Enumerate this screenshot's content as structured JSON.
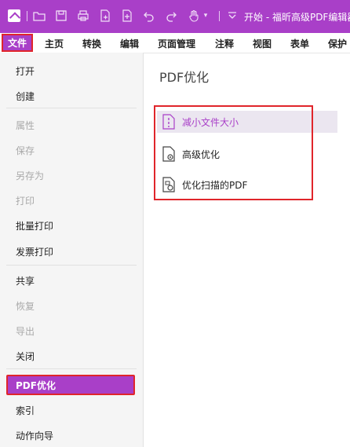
{
  "window": {
    "title": "开始 - 福昕高级PDF编辑器",
    "accent_color": "#a93fc8",
    "highlight_color": "#e0252b"
  },
  "quick_access": [
    "open-folder-icon",
    "save-icon",
    "print-icon",
    "new-doc-icon",
    "add-page-icon",
    "undo-icon",
    "redo-icon",
    "hand-tool-icon",
    "dropdown-icon"
  ],
  "menu": {
    "items": [
      "文件",
      "主页",
      "转换",
      "编辑",
      "页面管理",
      "注释",
      "视图",
      "表单",
      "保护"
    ],
    "active": "文件"
  },
  "sidebar": {
    "items": [
      {
        "label": "打开",
        "disabled": false
      },
      {
        "label": "创建",
        "disabled": false
      },
      {
        "label": "属性",
        "disabled": true
      },
      {
        "label": "保存",
        "disabled": true
      },
      {
        "label": "另存为",
        "disabled": true
      },
      {
        "label": "打印",
        "disabled": true
      },
      {
        "label": "批量打印",
        "disabled": false
      },
      {
        "label": "发票打印",
        "disabled": false
      },
      {
        "label": "共享",
        "disabled": false
      },
      {
        "label": "恢复",
        "disabled": true
      },
      {
        "label": "导出",
        "disabled": true
      },
      {
        "label": "关闭",
        "disabled": false
      },
      {
        "label": "PDF优化",
        "disabled": false
      },
      {
        "label": "索引",
        "disabled": false
      },
      {
        "label": "动作向导",
        "disabled": false
      }
    ],
    "active": "PDF优化"
  },
  "content": {
    "title": "PDF优化",
    "options": [
      {
        "label": "减小文件大小",
        "icon": "reduce-size-icon",
        "selected": true
      },
      {
        "label": "高级优化",
        "icon": "advanced-optimize-icon",
        "selected": false
      },
      {
        "label": "优化扫描的PDF",
        "icon": "optimize-scanned-icon",
        "selected": false
      }
    ]
  }
}
